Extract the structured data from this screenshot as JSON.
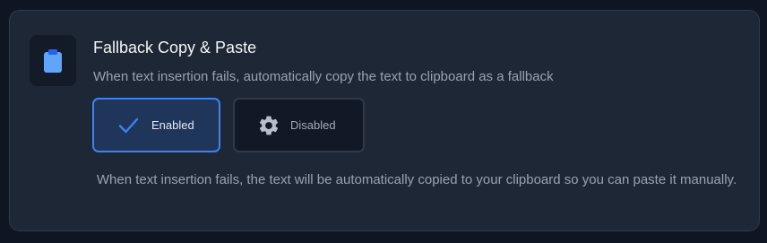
{
  "setting": {
    "title": "Fallback Copy & Paste",
    "description": "When text insertion fails, automatically copy the text to clipboard as a fallback",
    "icon": "clipboard-icon",
    "options": [
      {
        "label": "Enabled",
        "icon": "checkmark-icon",
        "selected": true
      },
      {
        "label": "Disabled",
        "icon": "gear-icon",
        "selected": false
      }
    ],
    "note": "When text insertion fails, the text will be automatically copied to your clipboard so you can paste it manually."
  },
  "colors": {
    "accent": "#3b82f6",
    "icon_blue": "#60a5fa",
    "card_bg": "#1d2735",
    "page_bg": "#0f1623"
  }
}
